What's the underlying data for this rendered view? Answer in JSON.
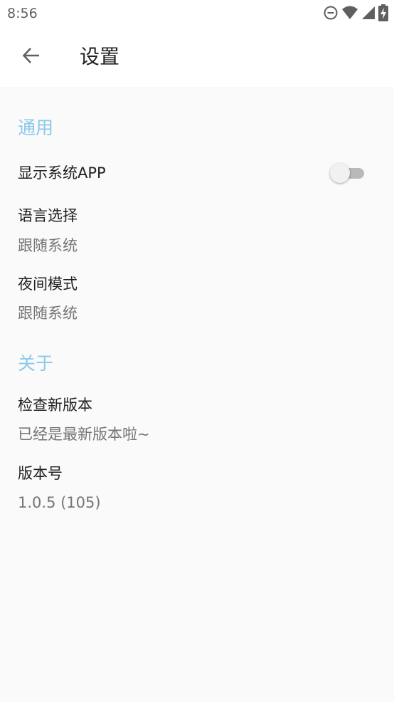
{
  "status_bar": {
    "time": "8:56",
    "icons": [
      "do-not-disturb-icon",
      "wifi-icon",
      "signal-icon",
      "battery-charging-icon"
    ]
  },
  "app_bar": {
    "title": "设置",
    "back_icon": "arrow-back-icon"
  },
  "sections": [
    {
      "header": "通用",
      "items": [
        {
          "title": "显示系统APP",
          "type": "switch",
          "checked": false
        },
        {
          "title": "语言选择",
          "summary": "跟随系统"
        },
        {
          "title": "夜间模式",
          "summary": "跟随系统"
        }
      ]
    },
    {
      "header": "关于",
      "items": [
        {
          "title": "检查新版本",
          "summary": "已经是最新版本啦~"
        },
        {
          "title": "版本号",
          "summary": "1.0.5 (105)"
        }
      ]
    }
  ],
  "colors": {
    "accent": "#8ac8ec",
    "title_text": "#212121",
    "summary_text": "#757575",
    "background": "#fafafa",
    "bar_background": "#ffffff"
  }
}
